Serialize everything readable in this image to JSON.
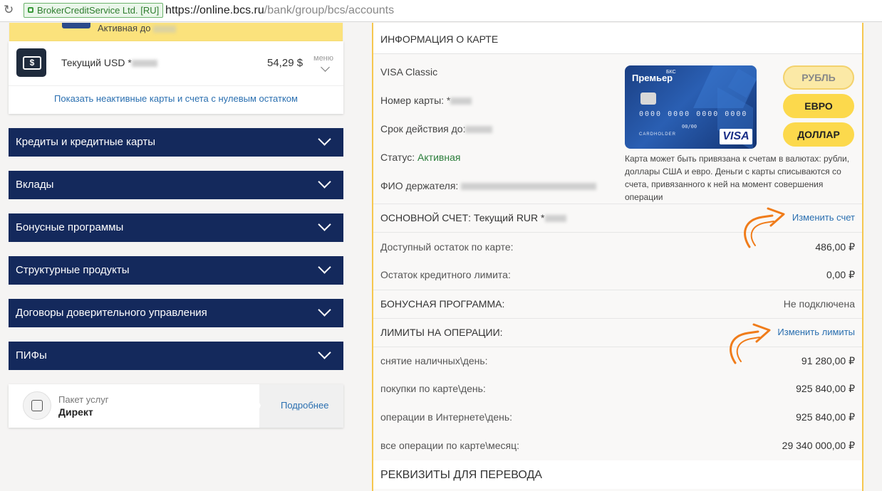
{
  "browser": {
    "ev_cert": "BrokerCreditService Ltd. [RU]",
    "url_host": "https://online.bcs.ru",
    "url_path": "/bank/group/bcs/accounts"
  },
  "left": {
    "prev_card_status": "Активная до",
    "account": {
      "name": "Текущий USD *",
      "amount": "54,29 $",
      "menu": "меню"
    },
    "show_inactive": "Показать неактивные карты и счета с нулевым остатком",
    "sections": [
      {
        "label": "Кредиты и кредитные карты"
      },
      {
        "label": "Вклады"
      },
      {
        "label": "Бонусные программы"
      },
      {
        "label": "Структурные продукты"
      },
      {
        "label": "Договоры доверительного управления"
      },
      {
        "label": "ПИФы"
      }
    ],
    "package": {
      "title": "Пакет услуг",
      "name": "Директ",
      "more": "Подробнее"
    }
  },
  "card_info": {
    "header": "ИНФОРМАЦИЯ О КАРТЕ",
    "type": "VISA Classic",
    "number_label": "Номер карты: *",
    "expiry_label": "Срок действия до:",
    "status_label": "Статус:",
    "status_value": "Активная",
    "holder_label": "ФИО держателя:",
    "card_brand": "Премьер",
    "card_brand_small": "БКС",
    "card_number_mask": "0000 0000 0000 0000",
    "card_expiry_mask": "00/00",
    "card_holder": "CARDHOLDER",
    "card_network": "VISA",
    "currencies": [
      {
        "label": "РУБЛЬ",
        "active": true
      },
      {
        "label": "ЕВРО",
        "active": false
      },
      {
        "label": "ДОЛЛАР",
        "active": false
      }
    ],
    "note": "Карта может быть привязана к счетам в валютах: рубли, доллары США и евро. Деньги с карты списываются со счета, привязанного к ней на момент совершения операции",
    "main_account_label": "ОСНОВНОЙ СЧЕТ: Текущий RUR *",
    "change_account": "Изменить счет",
    "available_label": "Доступный остаток по карте:",
    "available_value": "486,00 ₽",
    "credit_label": "Остаток кредитного лимита:",
    "credit_value": "0,00 ₽",
    "bonus_label": "БОНУСНАЯ ПРОГРАММА:",
    "bonus_value": "Не подключена",
    "limits_label": "ЛИМИТЫ НА ОПЕРАЦИИ:",
    "change_limits": "Изменить лимиты",
    "limits": [
      {
        "label": "снятие наличных\\день:",
        "value": "91 280,00 ₽"
      },
      {
        "label": "покупки по карте\\день:",
        "value": "925 840,00 ₽"
      },
      {
        "label": "операции в Интернете\\день:",
        "value": "925 840,00 ₽"
      },
      {
        "label": "все операции по карте\\месяц:",
        "value": "29 340 000,00 ₽"
      }
    ],
    "requisites": "РЕКВИЗИТЫ ДЛЯ ПЕРЕВОДА"
  },
  "colors": {
    "nav_blue": "#14295c",
    "accent_yellow": "#fcd94c",
    "link_blue": "#2a6fb0",
    "arrow_orange": "#f07c1a"
  }
}
